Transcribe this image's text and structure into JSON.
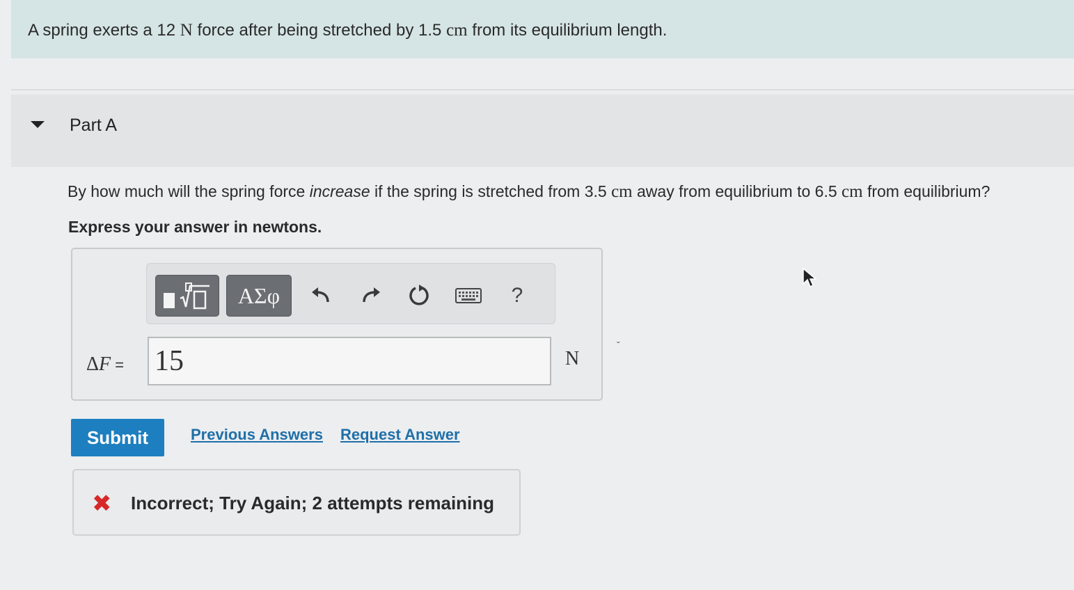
{
  "problem": {
    "text_before": "A spring exerts a 12 ",
    "force_unit": "N",
    "text_middle": " force after being stretched by 1.5 ",
    "length_unit": "cm",
    "text_after": " from its equilibrium length."
  },
  "part": {
    "title": "Part A"
  },
  "question": {
    "text_1": "By how much will the spring force ",
    "emphasis": "increase",
    "text_2": " if the spring is stretched from 3.5 ",
    "unit_1": "cm",
    "text_3": " away from equilibrium to 6.5 ",
    "unit_2": "cm",
    "text_4": " from equilibrium?",
    "instruction": "Express your answer in newtons."
  },
  "toolbar": {
    "greek_label": "ΑΣφ",
    "help_label": "?"
  },
  "answer": {
    "delta_symbol": "Δ",
    "variable": "F",
    "equals": " =",
    "value": "15",
    "unit": "N"
  },
  "actions": {
    "submit_label": "Submit",
    "previous_answers_label": "Previous Answers",
    "request_answer_label": "Request Answer"
  },
  "feedback": {
    "icon": "x-mark-icon",
    "text": "Incorrect; Try Again; 2 attempts remaining",
    "color": "#d62828"
  },
  "colors": {
    "submit": "#1d7fbf",
    "link": "#1f6fa8",
    "banner": "#d5e4e4"
  }
}
